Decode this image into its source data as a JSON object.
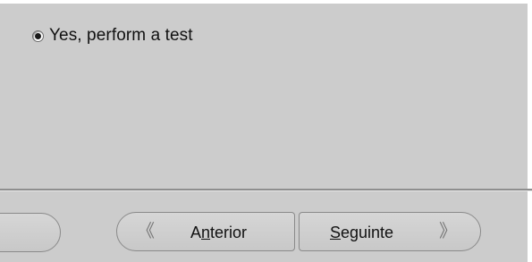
{
  "options": {
    "test_radio": {
      "label": "Yes, perform a test",
      "selected": true
    }
  },
  "navigation": {
    "back": {
      "label_prefix": "A",
      "label_mnemonic": "n",
      "label_suffix": "terior",
      "icon": "double-chevron-left-icon"
    },
    "next": {
      "label_prefix": "",
      "label_mnemonic": "S",
      "label_suffix": "eguinte",
      "icon": "double-chevron-right-icon"
    }
  }
}
